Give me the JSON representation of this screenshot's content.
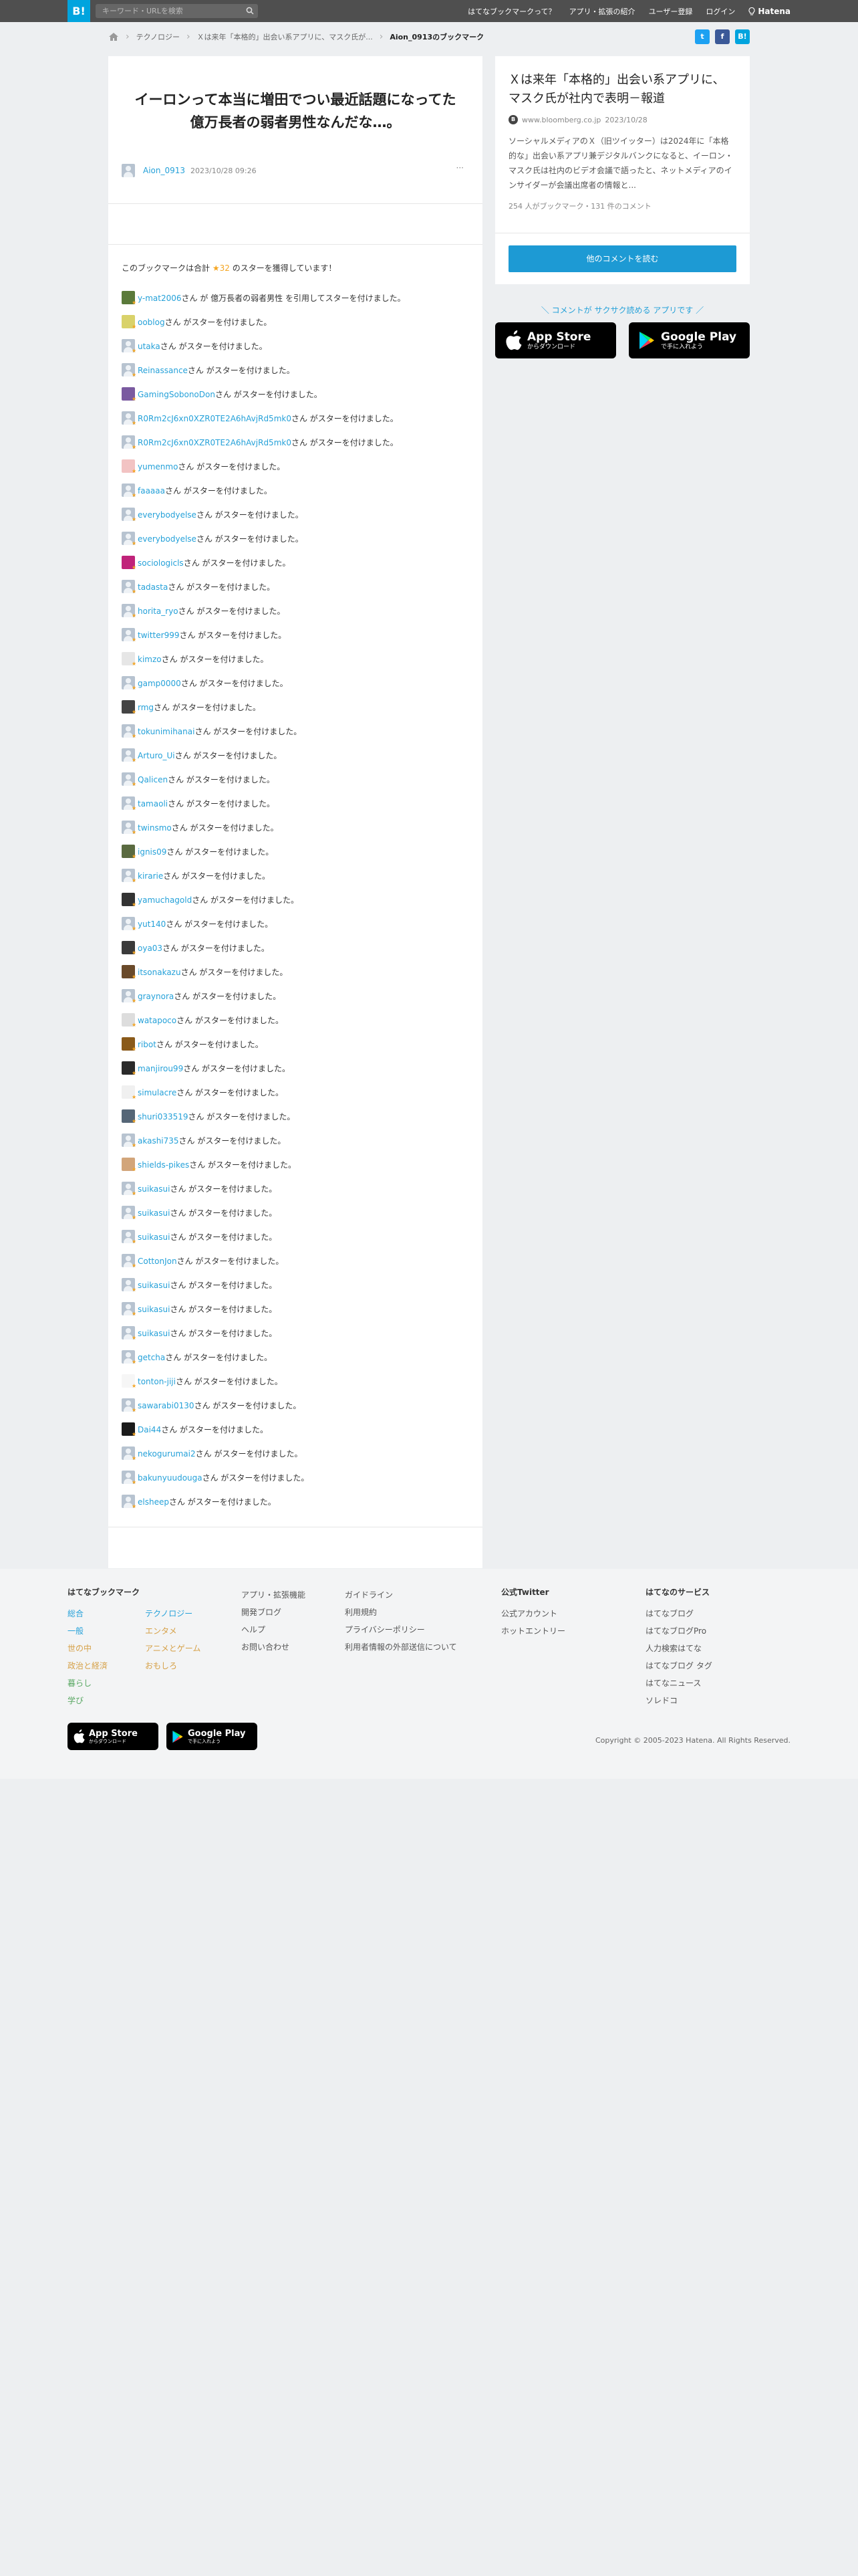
{
  "header": {
    "logo": "B!",
    "search_placeholder": "キーワード・URLを検索",
    "nav": [
      "はてなブックマークって？",
      "アプリ・拡張の紹介",
      "ユーザー登録",
      "ログイン"
    ],
    "brand": "Hatena"
  },
  "breadcrumb": {
    "items": [
      "テクノロジー",
      "Ｘは来年「本格的」出会い系アプリに、マスク氏が...",
      "Aion_0913のブックマーク"
    ]
  },
  "share": {
    "twitter": "t",
    "facebook": "f",
    "hatena": "B!"
  },
  "entry": {
    "headline": "イーロンって本当に増田でつい最近話題になってた億万長者の弱者男性なんだな…。",
    "user": "Aion_0913",
    "date": "2023/10/28 09:26",
    "more": "···"
  },
  "stars": {
    "summary_prefix": "このブックマークは合計",
    "count": "★32",
    "summary_suffix": "のスターを獲得しています！",
    "suffix_text": "さん がスターを付けました。",
    "quote_text": "さん が 億万長者の弱者男性 を引用してスターを付けました。",
    "rows": [
      {
        "name": "y-mat2006",
        "quote": true,
        "avatar": "photo",
        "color": "#5a7a3a"
      },
      {
        "name": "ooblog",
        "avatar": "photo",
        "color": "#d9d26a"
      },
      {
        "name": "utaka",
        "avatar": "default"
      },
      {
        "name": "Reinassance",
        "avatar": "default"
      },
      {
        "name": "GamingSobonoDon",
        "avatar": "photo",
        "color": "#7a5aa0"
      },
      {
        "name": "R0Rm2cJ6xn0XZR0TE2A6hAvjRd5mk0",
        "avatar": "default"
      },
      {
        "name": "R0Rm2cJ6xn0XZR0TE2A6hAvjRd5mk0",
        "avatar": "default"
      },
      {
        "name": "yumenmo",
        "avatar": "photo",
        "color": "#f2c3c3"
      },
      {
        "name": "faaaaa",
        "avatar": "default"
      },
      {
        "name": "everybodyelse",
        "avatar": "default"
      },
      {
        "name": "everybodyelse",
        "avatar": "default"
      },
      {
        "name": "sociologicls",
        "avatar": "photo",
        "color": "#c0237a"
      },
      {
        "name": "tadasta",
        "avatar": "default"
      },
      {
        "name": "horita_ryo",
        "avatar": "default"
      },
      {
        "name": "twitter999",
        "avatar": "default"
      },
      {
        "name": "kimzo",
        "avatar": "photo",
        "color": "#e6e6e6"
      },
      {
        "name": "gamp0000",
        "avatar": "default"
      },
      {
        "name": "rmg",
        "avatar": "photo",
        "color": "#444444"
      },
      {
        "name": "tokunimihanai",
        "avatar": "default"
      },
      {
        "name": "Arturo_Ui",
        "avatar": "default"
      },
      {
        "name": "Qalicen",
        "avatar": "default"
      },
      {
        "name": "tamaoli",
        "avatar": "default"
      },
      {
        "name": "twinsmo",
        "avatar": "default"
      },
      {
        "name": "ignis09",
        "avatar": "photo",
        "color": "#5a6a40"
      },
      {
        "name": "kirarie",
        "avatar": "default"
      },
      {
        "name": "yamuchagold",
        "avatar": "photo",
        "color": "#333333"
      },
      {
        "name": "yut140",
        "avatar": "default"
      },
      {
        "name": "oya03",
        "avatar": "photo",
        "color": "#3a3a3a"
      },
      {
        "name": "itsonakazu",
        "avatar": "photo",
        "color": "#6a4a2a"
      },
      {
        "name": "graynora",
        "avatar": "default"
      },
      {
        "name": "watapoco",
        "avatar": "photo",
        "color": "#dddddd"
      },
      {
        "name": "ribot",
        "avatar": "photo",
        "color": "#8a5a1a"
      },
      {
        "name": "manjirou99",
        "avatar": "photo",
        "color": "#2a2a2a"
      },
      {
        "name": "simulacre",
        "avatar": "photo",
        "color": "#f0f0f0"
      },
      {
        "name": "shuri033519",
        "avatar": "photo",
        "color": "#556677"
      },
      {
        "name": "akashi735",
        "avatar": "default"
      },
      {
        "name": "shields-pikes",
        "avatar": "photo",
        "color": "#d2a57a"
      },
      {
        "name": "suikasui",
        "avatar": "default"
      },
      {
        "name": "suikasui",
        "avatar": "default"
      },
      {
        "name": "suikasui",
        "avatar": "default"
      },
      {
        "name": "CottonJon",
        "avatar": "default"
      },
      {
        "name": "suikasui",
        "avatar": "default"
      },
      {
        "name": "suikasui",
        "avatar": "default"
      },
      {
        "name": "suikasui",
        "avatar": "default"
      },
      {
        "name": "getcha",
        "avatar": "default"
      },
      {
        "name": "tonton-jiji",
        "avatar": "photo",
        "color": "#f6f6f6"
      },
      {
        "name": "sawarabi0130",
        "avatar": "default"
      },
      {
        "name": "Dai44",
        "avatar": "photo",
        "color": "#1a1a1a"
      },
      {
        "name": "nekogurumai2",
        "avatar": "default"
      },
      {
        "name": "bakunyuudouga",
        "avatar": "default"
      },
      {
        "name": "elsheep",
        "avatar": "default"
      }
    ]
  },
  "sidebar": {
    "title": "Ｘは来年「本格的」出会い系アプリに、マスク氏が社内で表明－報道",
    "source_icon": "B",
    "source": "www.bloomberg.co.jp",
    "date": "2023/10/28",
    "description": "ソーシャルメディアのＸ（旧ツイッター）は2024年に「本格的な」出会い系アプリ兼デジタルバンクになると、イーロン・マスク氏は社内のビデオ会議で語ったと、ネットメディアのインサイダーが会議出席者の情報と...",
    "counts": "254 人がブックマーク・131 件のコメント",
    "read_button": "他のコメントを読む"
  },
  "promo": {
    "text": "＼ コメントが サクサク読める アプリです ／",
    "appstore_big": "App Store",
    "appstore_small": "からダウンロード",
    "gplay_big": "Google Play",
    "gplay_small": "で手に入れよう"
  },
  "footer": {
    "heading1": "はてなブックマーク",
    "col1": [
      "総合",
      "一般",
      "世の中",
      "政治と経済",
      "暮らし",
      "学び"
    ],
    "col1_colors": [
      "#25a1d9",
      "#25a1d9",
      "#d6a148",
      "#d6a148",
      "#5aa864",
      "#5aa864"
    ],
    "col2": [
      "テクノロジー",
      "エンタメ",
      "アニメとゲーム",
      "おもしろ"
    ],
    "col2_colors": [
      "#25a1d9",
      "#d6a148",
      "#d6a148",
      "#d6a148"
    ],
    "col3": [
      "アプリ・拡張機能",
      "開発ブログ",
      "ヘルプ",
      "お問い合わせ"
    ],
    "col4": [
      "ガイドライン",
      "利用規約",
      "プライバシーポリシー",
      "利用者情報の外部送信について"
    ],
    "heading5": "公式Twitter",
    "col5": [
      "公式アカウント",
      "ホットエントリー"
    ],
    "heading6": "はてなのサービス",
    "col6": [
      "はてなブログ",
      "はてなブログPro",
      "人力検索はてな",
      "はてなブログ タグ",
      "はてなニュース",
      "ソレドコ"
    ],
    "copyright": "Copyright © 2005-2023 Hatena. All Rights Reserved."
  }
}
